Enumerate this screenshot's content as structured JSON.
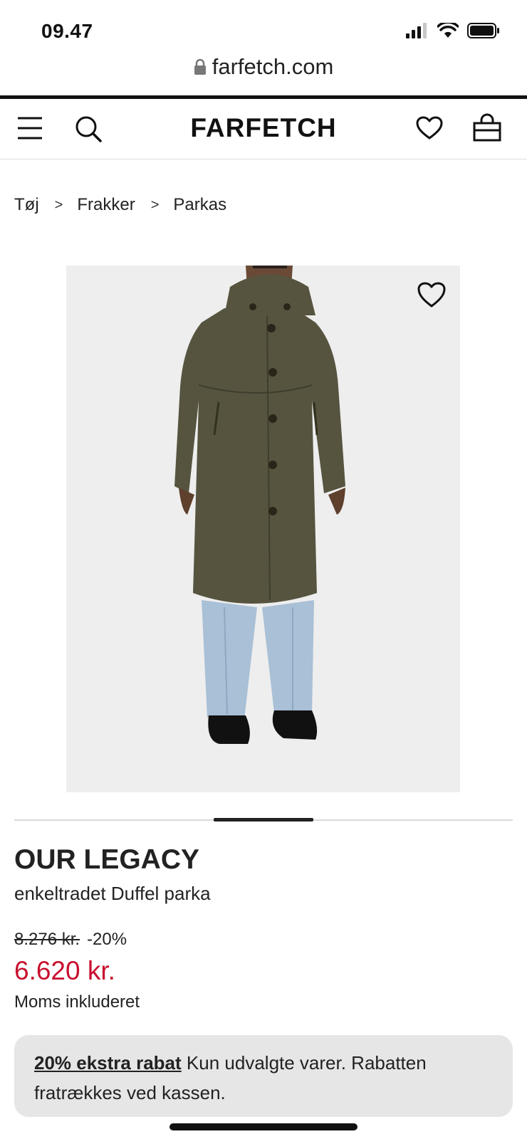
{
  "status_bar": {
    "time": "09.47"
  },
  "browser": {
    "url": "farfetch.com"
  },
  "header": {
    "logo": "FARFETCH"
  },
  "breadcrumb": [
    "Tøj",
    "Frakker",
    "Parkas"
  ],
  "breadcrumb_separator": ">",
  "product": {
    "brand": "OUR LEGACY",
    "name": "enkeltradet Duffel parka",
    "old_price": "8.276 kr.",
    "discount": "-20%",
    "price": "6.620 kr.",
    "vat_note": "Moms inkluderet",
    "image_alt": "Model wearing olive wool duffel parka with light blue jeans"
  },
  "promo": {
    "link_text": "20% ekstra rabat",
    "text": "Kun udvalgte varer. Rabatten fratrækkes ved kassen."
  },
  "colors": {
    "sale_red": "#c8102e",
    "promo_bg": "#e6e6e6",
    "coat": "#56543f",
    "jeans": "#a9c0d6"
  }
}
